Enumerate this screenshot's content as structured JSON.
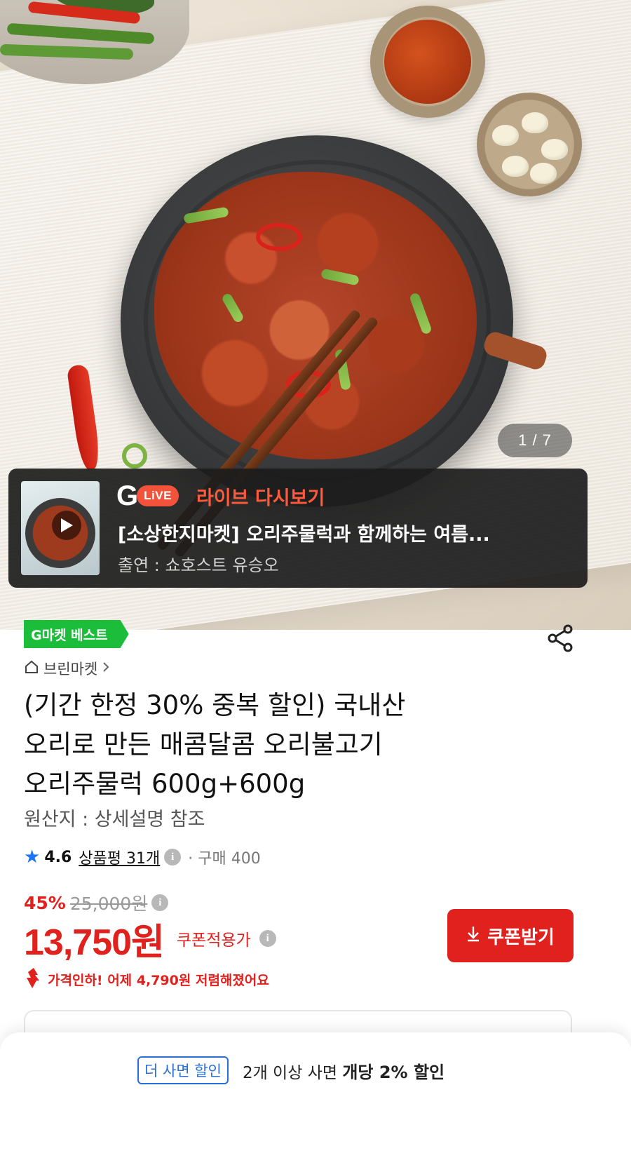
{
  "hero": {
    "counter": "1 / 7"
  },
  "live": {
    "logo_g": "G",
    "logo_pill": "LiVE",
    "label": "라이브 다시보기",
    "title": "[소상한지마켓] 오리주물럭과 함께하는 여름...",
    "cast": "출연 : 쇼호스트 유승오",
    "play_icon": "play-icon"
  },
  "product": {
    "badge": "G마켓 베스트",
    "store": "브린마켓",
    "title_lines": [
      "(기간 한정 30% 중복 할인) 국내산",
      "오리로 만든 매콤달콤 오리불고기",
      "오리주물럭 600g+600g"
    ],
    "origin": "원산지 : 상세설명 참조",
    "rating": "4.6",
    "review": "상품평 31개",
    "purchase": "· 구매 400",
    "discount_rate": "45%",
    "original_price": "25,000원",
    "price": "13,750원",
    "coupon_price_label": "쿠폰적용가",
    "coupon_button": "쿠폰받기",
    "price_drop": "가격인하! 어제 4,790원 저렴해졌어요"
  },
  "bottom": {
    "badge": "더 사면 할인",
    "text": "2개 이상 사면",
    "strong": "개당 2% 할인"
  },
  "colors": {
    "accent_red": "#e0211d",
    "best_green": "#1dbd3c",
    "star_blue": "#1f74f5",
    "live_orange": "#ff5a3c"
  }
}
